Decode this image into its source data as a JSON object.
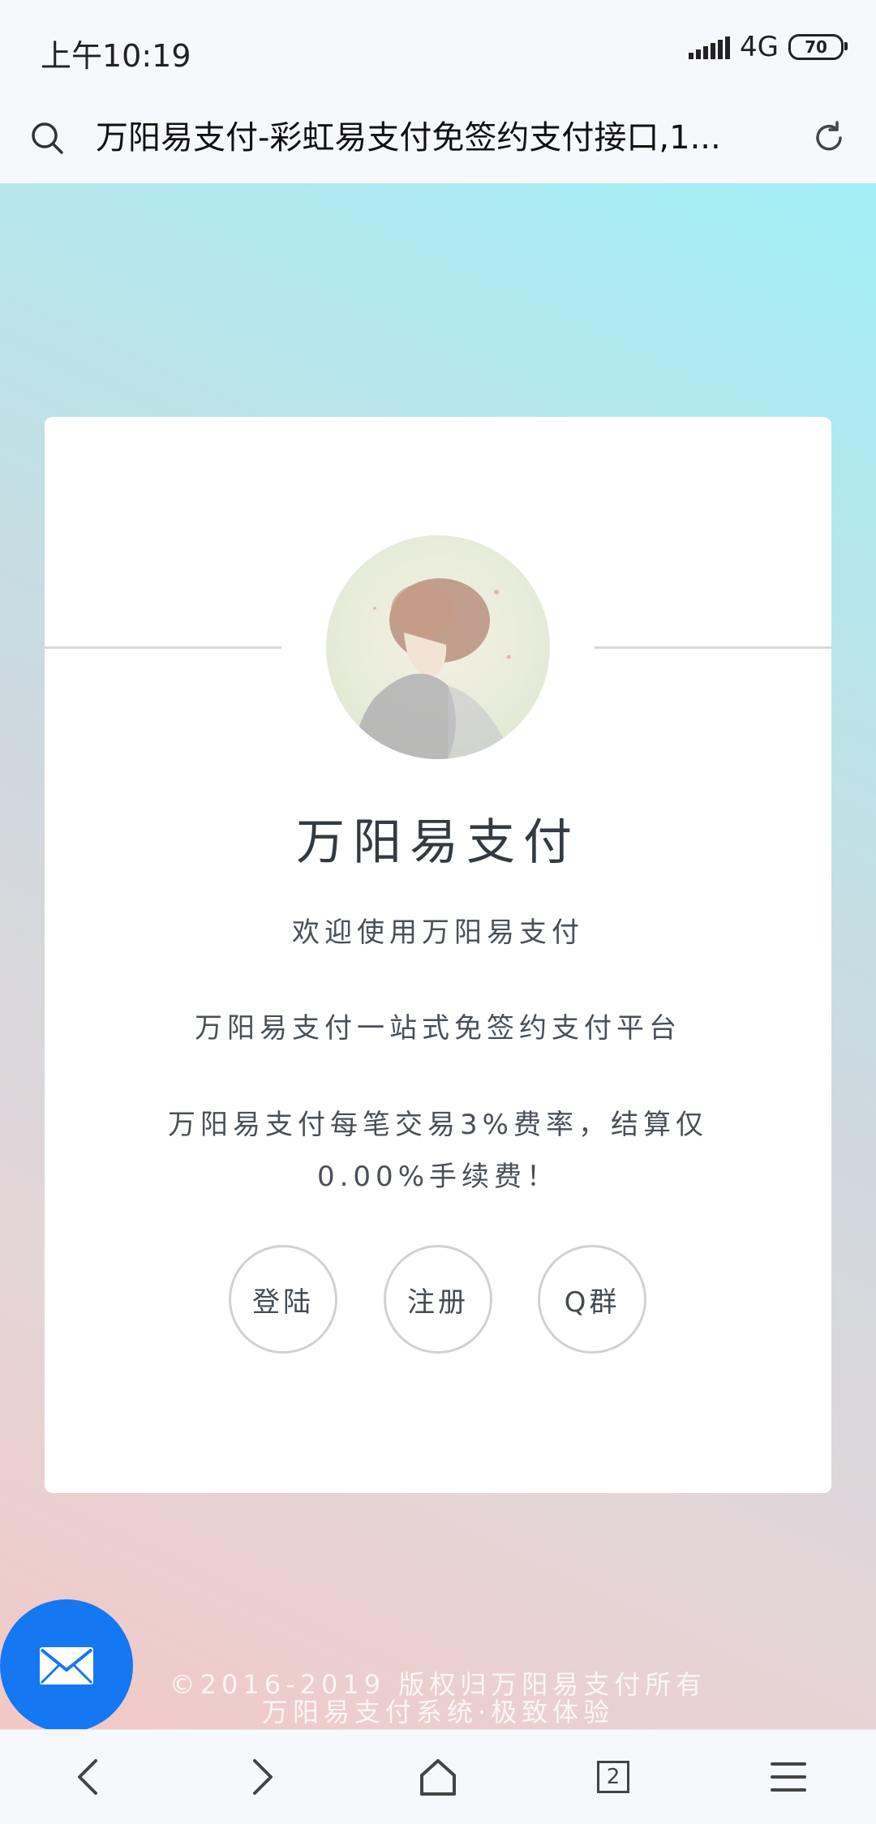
{
  "status_bar": {
    "time": "上午10:19",
    "network": "4G",
    "battery": "70"
  },
  "browser": {
    "page_title": "万阳易支付-彩虹易支付免签约支付接口,1...",
    "tab_count": "2"
  },
  "card": {
    "title": "万阳易支付",
    "welcome": "欢迎使用万阳易支付",
    "tagline": "万阳易支付一站式免签约支付平台",
    "fee_text": "万阳易支付每笔交易3%费率，结算仅0.00%手续费！",
    "buttons": {
      "login": "登陆",
      "register": "注册",
      "qgroup": "Q群"
    }
  },
  "footer": {
    "copyright": "©2016-2019 版权归万阳易支付所有",
    "slogan": "万阳易支付系统·极致体验"
  },
  "colors": {
    "fab": "#1677f2",
    "card_bg": "#ffffff"
  },
  "icons": {
    "address_left": "search-icon",
    "address_right": "refresh-icon",
    "fab": "mail-icon",
    "nav": [
      "back-icon",
      "forward-icon",
      "home-icon",
      "tabs-icon",
      "menu-icon"
    ]
  }
}
